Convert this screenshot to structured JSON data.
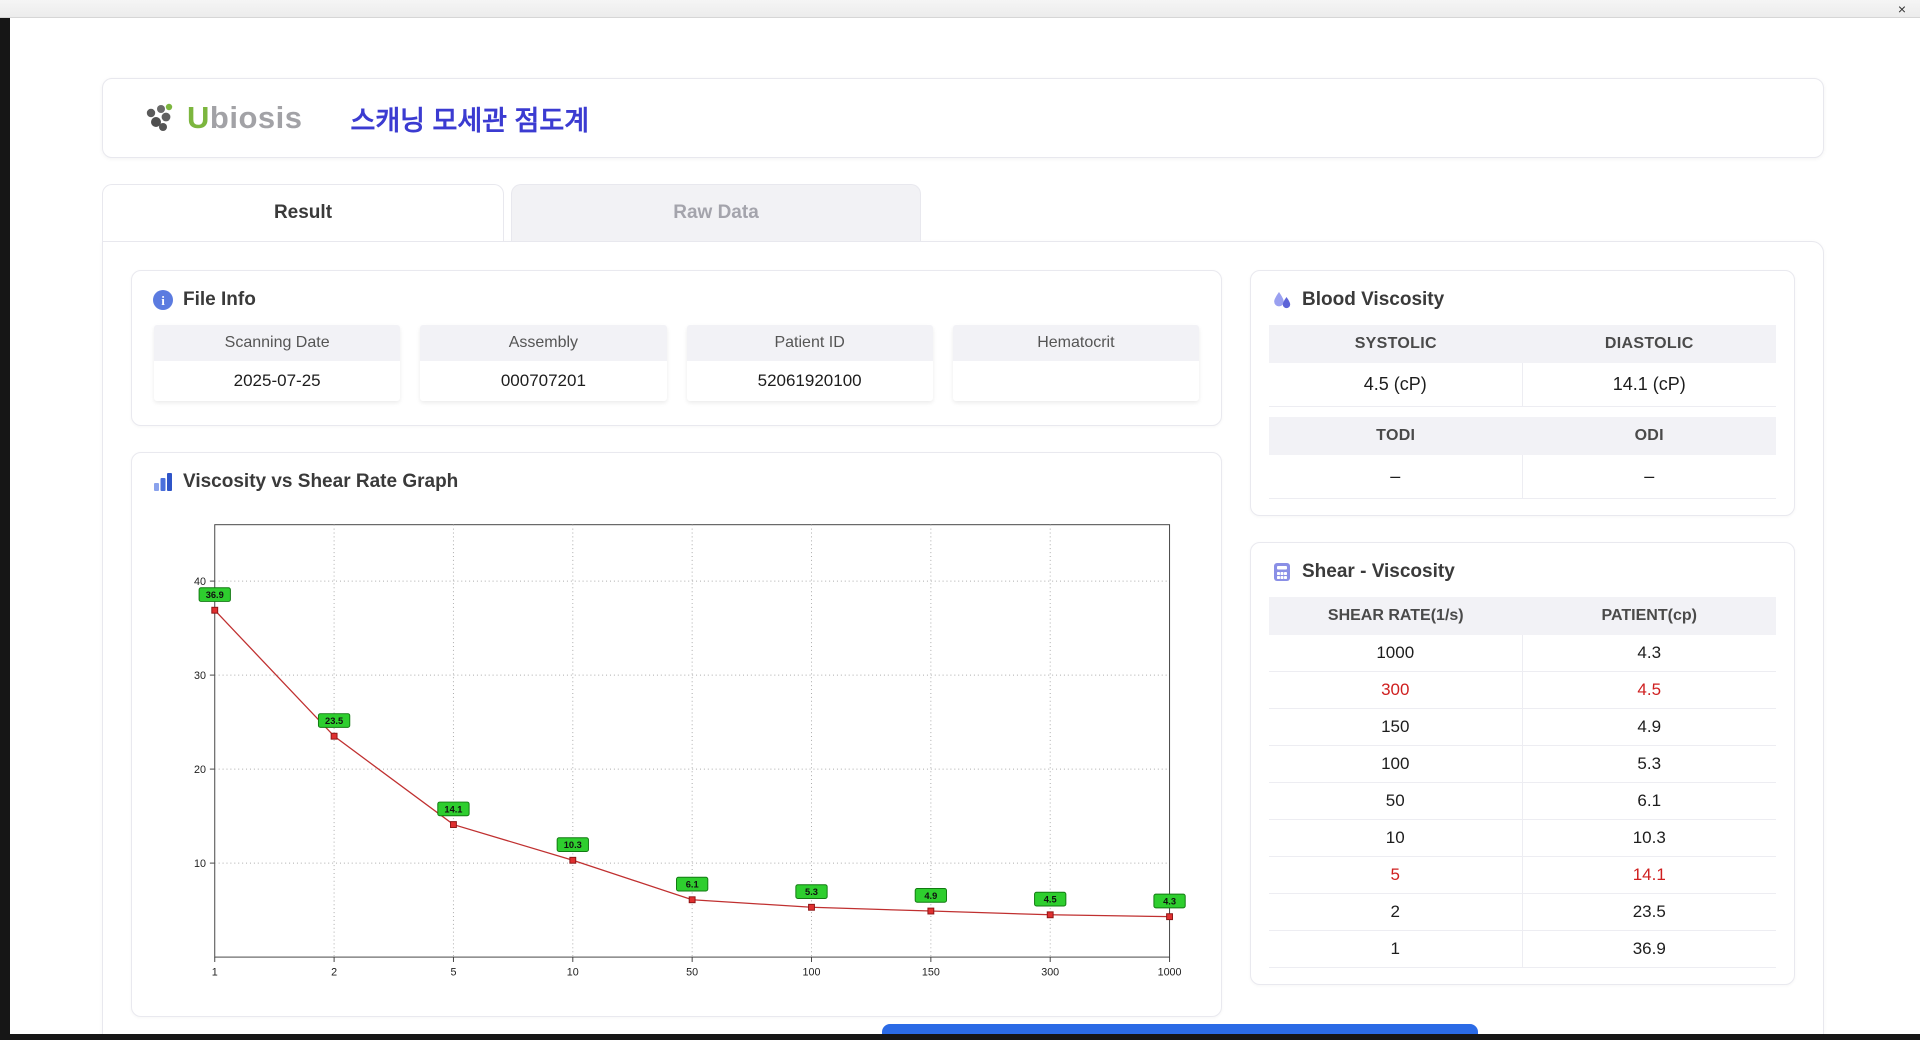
{
  "window": {
    "close_label": "×"
  },
  "header": {
    "brand": "Ubiosis",
    "title": "스캐닝 모세관 점도계"
  },
  "tabs": [
    {
      "label": "Result",
      "active": true
    },
    {
      "label": "Raw Data",
      "active": false
    }
  ],
  "file_info": {
    "title": "File Info",
    "fields": [
      {
        "label": "Scanning Date",
        "value": "2025-07-25"
      },
      {
        "label": "Assembly",
        "value": "000707201"
      },
      {
        "label": "Patient ID",
        "value": "52061920100"
      },
      {
        "label": "Hematocrit",
        "value": ""
      }
    ]
  },
  "graph": {
    "title": "Viscosity vs Shear Rate Graph"
  },
  "chart_data": {
    "type": "line",
    "title": "Viscosity vs Shear Rate Graph",
    "x_scale": "categorical",
    "categories": [
      "1",
      "2",
      "5",
      "10",
      "50",
      "100",
      "150",
      "300",
      "1000"
    ],
    "values": [
      36.9,
      23.5,
      14.1,
      10.3,
      6.1,
      5.3,
      4.9,
      4.5,
      4.3
    ],
    "xlabel": "",
    "ylabel": "",
    "ylim": [
      0,
      46
    ],
    "yticks": [
      10,
      20,
      30,
      40
    ],
    "grid": "dotted",
    "line_color": "#c03030",
    "marker_color": "#e03030",
    "marker_border": "#8d1515",
    "label_bg": "#2ece2e",
    "label_border": "#117a11",
    "legend": "none"
  },
  "blood_viscosity": {
    "title": "Blood Viscosity",
    "rows": [
      {
        "headers": [
          "SYSTOLIC",
          "DIASTOLIC"
        ],
        "values": [
          "4.5 (cP)",
          "14.1 (cP)"
        ]
      },
      {
        "headers": [
          "TODI",
          "ODI"
        ],
        "values": [
          "–",
          "–"
        ]
      }
    ]
  },
  "shear_viscosity": {
    "title": "Shear - Viscosity",
    "columns": [
      "SHEAR RATE(1/s)",
      "PATIENT(cp)"
    ],
    "rows": [
      {
        "shear": "1000",
        "patient": "4.3",
        "highlight": false
      },
      {
        "shear": "300",
        "patient": "4.5",
        "highlight": true
      },
      {
        "shear": "150",
        "patient": "4.9",
        "highlight": false
      },
      {
        "shear": "100",
        "patient": "5.3",
        "highlight": false
      },
      {
        "shear": "50",
        "patient": "6.1",
        "highlight": false
      },
      {
        "shear": "10",
        "patient": "10.3",
        "highlight": false
      },
      {
        "shear": "5",
        "patient": "14.1",
        "highlight": true
      },
      {
        "shear": "2",
        "patient": "23.5",
        "highlight": false
      },
      {
        "shear": "1",
        "patient": "36.9",
        "highlight": false
      }
    ]
  }
}
